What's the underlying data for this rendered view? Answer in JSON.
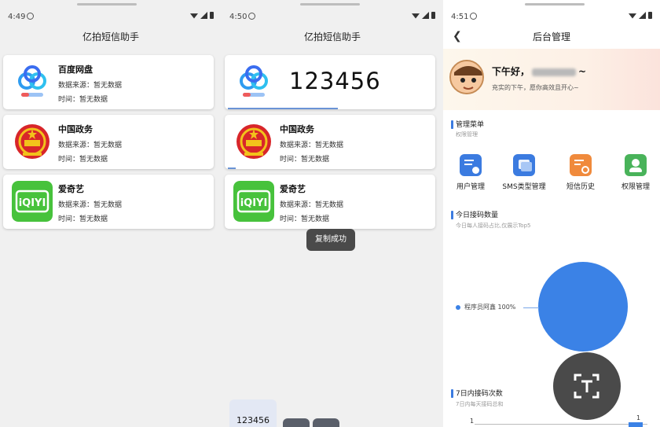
{
  "panel1": {
    "status_time": "4:49",
    "title": "亿拍短信助手",
    "cards": [
      {
        "name": "百度网盘",
        "source": "数据来源：暂无数据",
        "time": "时间：暂无数据"
      },
      {
        "name": "中国政务",
        "source": "数据来源：暂无数据",
        "time": "时间：暂无数据"
      },
      {
        "name": "爱奇艺",
        "source": "数据来源：暂无数据",
        "time": "时间：暂无数据"
      }
    ]
  },
  "panel2": {
    "status_time": "4:50",
    "title": "亿拍短信助手",
    "big_code": "123456",
    "cards": [
      {
        "name": "中国政务",
        "source": "数据来源：暂无数据",
        "time": "时间：暂无数据"
      },
      {
        "name": "爱奇艺",
        "source": "数据来源：暂无数据",
        "time": "时间：暂无数据"
      }
    ],
    "toast": "复制成功",
    "mini_code": "123456"
  },
  "panel3": {
    "status_time": "4:51",
    "title": "后台管理",
    "greeting_prefix": "下午好，",
    "greeting_suffix": "~",
    "subtitle": "充实的下午，愿你高效且开心~",
    "menu_section": {
      "title": "管理菜单",
      "sub": "权限管理"
    },
    "menu_items": [
      {
        "label": "用户管理",
        "icon": "user-manage-icon",
        "color": "#3b7be0"
      },
      {
        "label": "SMS类型管理",
        "icon": "sms-type-icon",
        "color": "#3b7be0"
      },
      {
        "label": "短信历史",
        "icon": "sms-history-icon",
        "color": "#f08a3c"
      },
      {
        "label": "权限管理",
        "icon": "permission-icon",
        "color": "#49b35a"
      }
    ],
    "today_section": {
      "title": "今日接码数量",
      "sub": "今日每人接码占比,仅展示Top5"
    },
    "week_section": {
      "title": "7日内接码次数",
      "sub": "7日内每天接码总和"
    }
  },
  "chart_data": {
    "type": "pie",
    "slices": [
      {
        "label": "程序员阿鑫",
        "percent": 100
      }
    ],
    "legend_text": "程序员阿鑫 100%",
    "color": "#3b82e6"
  },
  "bar_axis": {
    "left_tick": "1",
    "right_tick": "1"
  }
}
